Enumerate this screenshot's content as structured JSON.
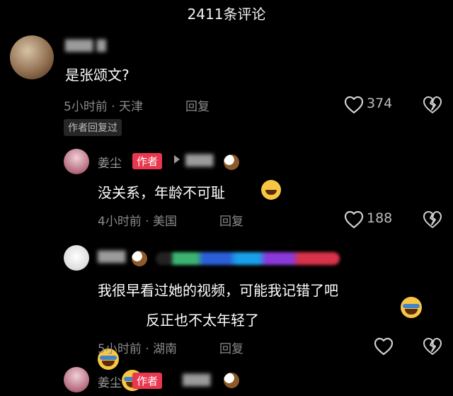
{
  "header": {
    "title": "2411条评论"
  },
  "comments": [
    {
      "text": "是张颂文?",
      "time": "5小时前 · 天津",
      "reply_label": "回复",
      "likes": "374",
      "author_badge": "作者回复过"
    },
    {
      "name": "姜尘",
      "author_tag": "作者",
      "text": "没关系，年龄不可耻",
      "time": "4小时前 · 美国",
      "reply_label": "回复",
      "likes": "188"
    },
    {
      "text_line1": "我很早看过她的视频，可能我记错了吧",
      "text_line2": "反正也不太年轻了",
      "time": "5小时前 · 湖南",
      "reply_label": "回复"
    },
    {
      "name": "姜尘",
      "author_tag": "作者"
    }
  ],
  "colors": {
    "background": "#000000",
    "author_tag": "#e8384f"
  }
}
